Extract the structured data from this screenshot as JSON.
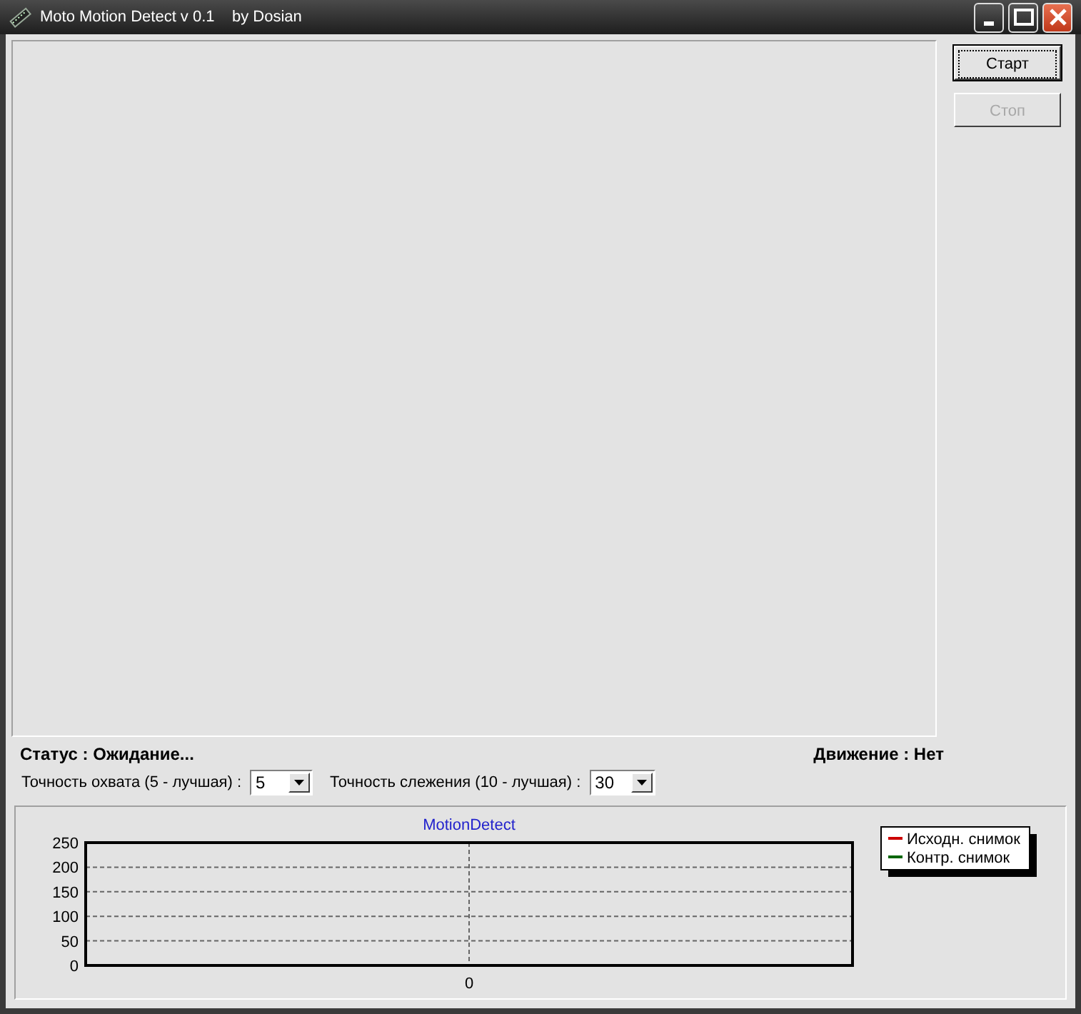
{
  "window": {
    "title": "Moto Motion Detect v 0.1    by Dosian"
  },
  "buttons": [
    {
      "label": "Старт",
      "disabled": false,
      "focused": true
    },
    {
      "label": "Стоп",
      "disabled": true,
      "focused": false
    }
  ],
  "status": "Статус : Ожидание...",
  "motion": "Движение : Нет",
  "settings": [
    {
      "label": "Точность охвата (5 - лучшая) :",
      "value": "5"
    },
    {
      "label": "Точность слежения (10 - лучшая) :",
      "value": "30"
    }
  ],
  "chart": {
    "title": "MotionDetect",
    "y_labels": [
      "250",
      "200",
      "150",
      "100",
      "50",
      "0"
    ],
    "x_labels": [
      "0"
    ],
    "legend": [
      {
        "name": "Исходн. снимок",
        "color": "#cc0000"
      },
      {
        "name": "Контр. снимок",
        "color": "#006600"
      }
    ]
  }
}
